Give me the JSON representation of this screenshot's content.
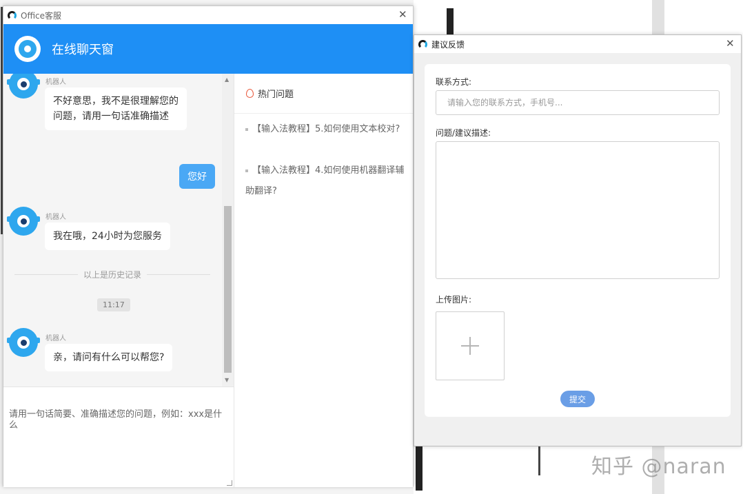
{
  "chat_window": {
    "title": "Office客服",
    "header_title": "在线聊天窗",
    "messages": [
      {
        "sender": "机器人",
        "text": "不好意思，我不是很理解您的问题，请用一句话准确描述"
      },
      {
        "sender": "user",
        "text": "您好"
      },
      {
        "sender": "机器人",
        "text": "我在哦，24小时为您服务"
      },
      {
        "sender": "机器人",
        "text": "亲，请问有什么可以帮您?"
      }
    ],
    "history_divider": "以上是历史记录",
    "time_tag": "11:17",
    "input_placeholder": "请用一句话简要、准确描述您的问题，例如：xxx是什么",
    "hot_title": "热门问题",
    "hot_items": [
      "【输入法教程】5.如何使用文本校对?",
      "【输入法教程】4.如何使用机器翻译辅助翻译?"
    ]
  },
  "feedback": {
    "title": "建议反馈",
    "contact_label": "联系方式:",
    "contact_placeholder": "请输入您的联系方式，手机号...",
    "desc_label": "问题/建议描述:",
    "upload_label": "上传图片:",
    "submit_label": "提交"
  },
  "watermark": "知乎 @naran",
  "colors": {
    "header_blue": "#1e8ff5",
    "user_bubble": "#4aa8f5",
    "submit": "#6a9ee6"
  }
}
